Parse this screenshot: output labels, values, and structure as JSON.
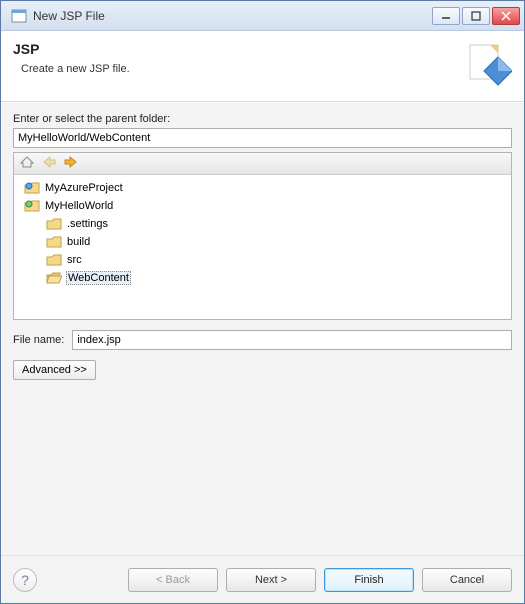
{
  "window": {
    "title": "New JSP File"
  },
  "banner": {
    "heading": "JSP",
    "subtext": "Create a new JSP file."
  },
  "form": {
    "parentLabel": "Enter or select the parent folder:",
    "parentValue": "MyHelloWorld/WebContent",
    "filenameLabel": "File name:",
    "filenameValue": "index.jsp",
    "advancedLabel": "Advanced >>"
  },
  "tree": {
    "nodes": [
      {
        "label": "MyAzureProject",
        "level": 0,
        "icon": "project",
        "selected": false
      },
      {
        "label": "MyHelloWorld",
        "level": 0,
        "icon": "project-web",
        "selected": false
      },
      {
        "label": ".settings",
        "level": 1,
        "icon": "folder",
        "selected": false
      },
      {
        "label": "build",
        "level": 1,
        "icon": "folder",
        "selected": false
      },
      {
        "label": "src",
        "level": 1,
        "icon": "folder",
        "selected": false
      },
      {
        "label": "WebContent",
        "level": 1,
        "icon": "folder-open",
        "selected": true
      }
    ]
  },
  "footer": {
    "back": "< Back",
    "next": "Next >",
    "finish": "Finish",
    "cancel": "Cancel"
  },
  "colors": {
    "accent": "#3c98d9"
  }
}
